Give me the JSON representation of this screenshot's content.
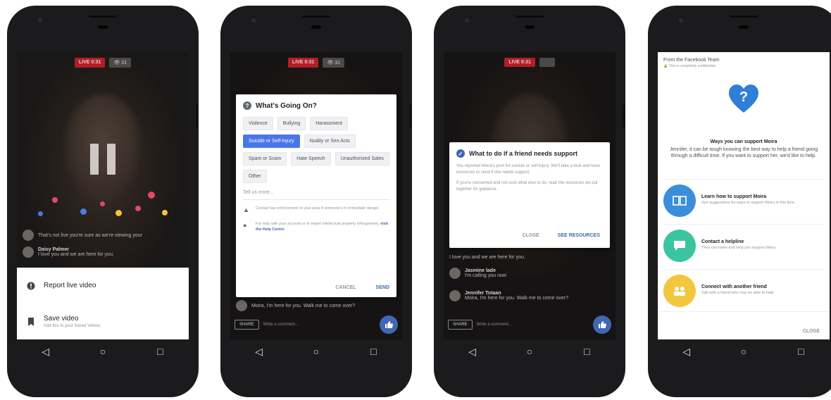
{
  "phone1": {
    "live_label": "LIVE 0:31",
    "views_label": "👁 31",
    "comments": [
      {
        "name": "",
        "text": "That's not live you're sure as we're viewing your"
      },
      {
        "name": "Daisy Palmer",
        "text": "I love you and we are here for you."
      }
    ],
    "sheet": {
      "report_label": "Report live video",
      "save_label": "Save video",
      "save_sub": "Add this to your Saved Videos."
    }
  },
  "phone2": {
    "live_label": "LIVE 0:31",
    "views_label": "👁 31",
    "title": "What's Going On?",
    "chips": [
      "Violence",
      "Bullying",
      "Harassment",
      "Suicide or Self-Injury",
      "Nudity or Sex Acts",
      "Spam or Scam",
      "Hate Speech",
      "Unauthorized Sales",
      "Other"
    ],
    "selected_chip": "Suicide or Self-Injury",
    "tell_us": "Tell us more...",
    "info1": "Contact law enforcement in your area if someone's in immediate danger.",
    "info2": "For help with your account or to report intellectual property infringement,",
    "info2_link": "visit the Help Centre",
    "cancel": "CANCEL",
    "send": "SEND",
    "share": "SHARE",
    "comment_placeholder": "Write a comment...",
    "comment_line": "Moira, I'm here for you. Walk me to come over?"
  },
  "phone3": {
    "live_label": "LIVE 0:31",
    "title": "What to do if a friend needs support",
    "p1": "You reported Moira's post for suicide or self-injury. We'll take a look and have resources to send if she needs support.",
    "p2": "If you're concerned and not sure what else to do, read the resources we put together for guidance.",
    "close": "CLOSE",
    "see": "SEE RESOURCES",
    "comments": [
      {
        "name": "",
        "text": "I love you and we are here for you."
      },
      {
        "name": "Jasmine lade",
        "text": "I'm calling you now"
      },
      {
        "name": "Jennifer Totaan",
        "text": "Moira, I'm here for you. Walk me to come over?"
      }
    ],
    "share": "SHARE",
    "comment_placeholder": "Write a comment..."
  },
  "phone4": {
    "header_title": "From the Facebook Team",
    "header_sub": "This is completely confidential",
    "heading": "Ways you can support Moira",
    "body": "Jennifer, it can be tough knowing the best way to help a friend going through a difficult time. If you want to support her, we'd like to help.",
    "options": [
      {
        "title": "Learn how to support Moira",
        "sub": "See suggestions for ways to support Moira in this time.",
        "color": "#3b8fd9",
        "icon": "book-icon"
      },
      {
        "title": "Contact a helpline",
        "sub": "They can listen and help you support Moira.",
        "color": "#3bc4a0",
        "icon": "chat-icon"
      },
      {
        "title": "Connect with another friend",
        "sub": "Talk with a friend who may be able to help.",
        "color": "#f3c73d",
        "icon": "people-icon"
      }
    ],
    "close": "CLOSE"
  },
  "nav": {
    "back": "◁",
    "home": "○",
    "recent": "□"
  },
  "colors": {
    "facebook_blue": "#4267b2",
    "live_red": "#b01f27",
    "selected_chip": "#4a76e8"
  }
}
